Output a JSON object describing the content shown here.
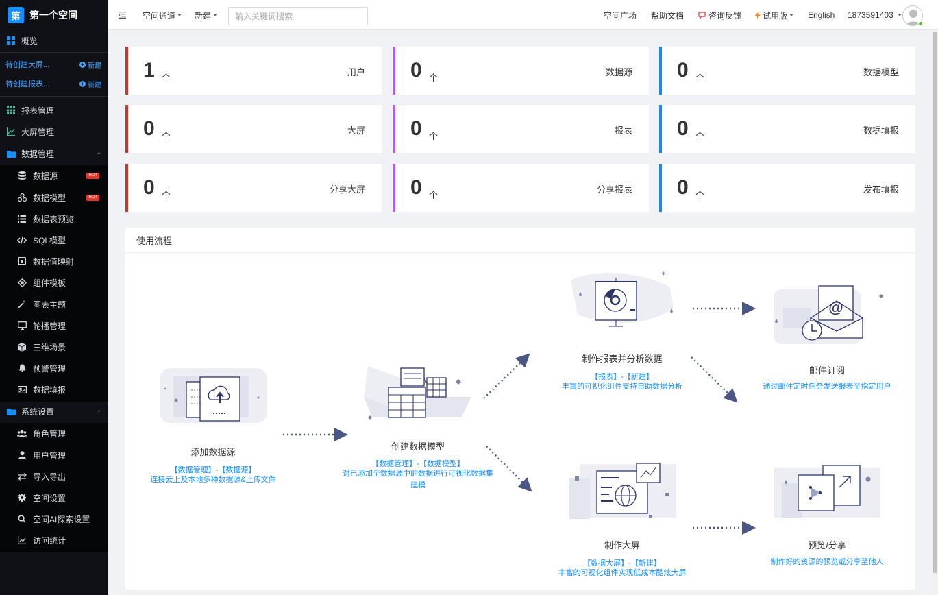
{
  "sidebar": {
    "logo_char": "第",
    "title": "第一个空间",
    "overview": "概览",
    "pending": [
      {
        "text": "待创建大屏...",
        "action": "新建"
      },
      {
        "text": "待创建报表...",
        "action": "新建"
      }
    ],
    "items": [
      {
        "label": "报表管理",
        "icon": "grid-icon"
      },
      {
        "label": "大屏管理",
        "icon": "line-chart-icon"
      },
      {
        "label": "数据管理",
        "icon": "folder-icon"
      },
      {
        "label": "数据源",
        "icon": "database-icon",
        "hot": "HOT"
      },
      {
        "label": "数据模型",
        "icon": "model-icon",
        "hot": "HOT"
      },
      {
        "label": "数据表预览",
        "icon": "list-icon"
      },
      {
        "label": "SQL模型",
        "icon": "code-icon"
      },
      {
        "label": "数据值映射",
        "icon": "mapping-icon"
      },
      {
        "label": "组件模板",
        "icon": "template-icon"
      },
      {
        "label": "图表主题",
        "icon": "magic-wand-icon"
      },
      {
        "label": "轮播管理",
        "icon": "monitor-icon"
      },
      {
        "label": "三维场景",
        "icon": "cube-icon"
      },
      {
        "label": "预警管理",
        "icon": "bell-icon"
      },
      {
        "label": "数据填报",
        "icon": "form-icon"
      },
      {
        "label": "系统设置",
        "icon": "folder-icon"
      },
      {
        "label": "角色管理",
        "icon": "users-icon"
      },
      {
        "label": "用户管理",
        "icon": "user-icon"
      },
      {
        "label": "导入导出",
        "icon": "exchange-icon"
      },
      {
        "label": "空间设置",
        "icon": "gear-icon"
      },
      {
        "label": "空间AI探索设置",
        "icon": "search-icon"
      },
      {
        "label": "访问统计",
        "icon": "stats-icon"
      }
    ]
  },
  "topbar": {
    "channel": "空间通道",
    "new": "新建",
    "search_placeholder": "输入关键词搜索",
    "plaza": "空间广场",
    "help": "帮助文档",
    "feedback": "咨询反馈",
    "trial": "试用版",
    "language": "English",
    "user": "1873591403"
  },
  "stats": [
    {
      "value": "1",
      "unit": "个",
      "label": "用户",
      "color": "#c0392b"
    },
    {
      "value": "0",
      "unit": "个",
      "label": "数据源",
      "color": "#b35ee6"
    },
    {
      "value": "0",
      "unit": "个",
      "label": "数据模型",
      "color": "#1e88e5"
    },
    {
      "value": "0",
      "unit": "个",
      "label": "大屏",
      "color": "#c0392b"
    },
    {
      "value": "0",
      "unit": "个",
      "label": "报表",
      "color": "#b35ee6"
    },
    {
      "value": "0",
      "unit": "个",
      "label": "数据填报",
      "color": "#1e88e5"
    },
    {
      "value": "0",
      "unit": "个",
      "label": "分享大屏",
      "color": "#c0392b"
    },
    {
      "value": "0",
      "unit": "个",
      "label": "分享报表",
      "color": "#b35ee6"
    },
    {
      "value": "0",
      "unit": "个",
      "label": "发布填报",
      "color": "#1e88e5"
    }
  ],
  "flow": {
    "title": "使用流程",
    "steps": [
      {
        "title": "添加数据源",
        "link": "【数据管理】-【数据源】",
        "desc": "连接云上及本地多种数据源&上传文件"
      },
      {
        "title": "创建数据模型",
        "link": "【数据管理】-【数据模型】",
        "desc": "对已添加至数据源中的数据进行可视化数据集建模"
      },
      {
        "title": "制作报表并分析数据",
        "link": "【报表】-【新建】",
        "desc": "丰富的可视化组件支持自助数据分析"
      },
      {
        "title": "邮件订阅",
        "link": "",
        "desc": "通过邮件定时任务发送报表至指定用户"
      },
      {
        "title": "制作大屏",
        "link": "【数据大屏】-【新建】",
        "desc": "丰富的可视化组件实现低成本酷炫大屏"
      },
      {
        "title": "预览/分享",
        "link": "",
        "desc": "制作好的资源的预览或分享至他人"
      }
    ]
  }
}
